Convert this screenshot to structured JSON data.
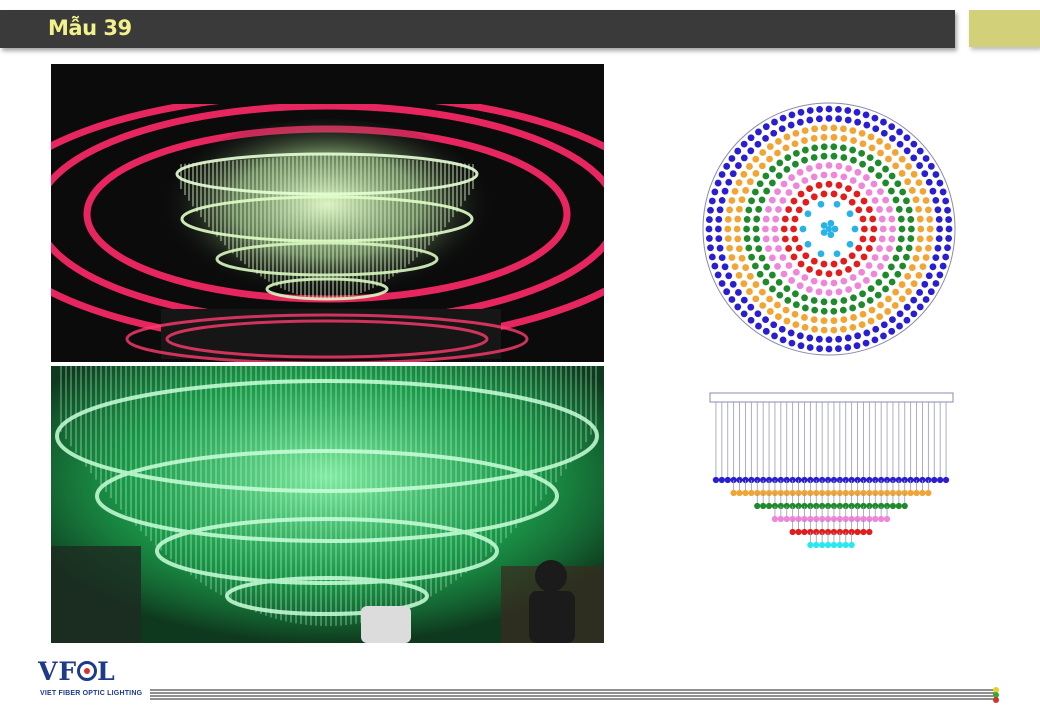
{
  "slide": {
    "title": "Mẫu 39",
    "logo": {
      "mark": "VFOL",
      "subtitle": "VIET FIBER OPTIC LIGHTING"
    }
  },
  "diagram": {
    "rings": [
      {
        "color": "#2a1ed1",
        "dots": 80
      },
      {
        "color": "#2a1ed1",
        "dots": 72
      },
      {
        "color": "#f2a534",
        "dots": 66
      },
      {
        "color": "#f2a534",
        "dots": 58
      },
      {
        "color": "#1f8a2b",
        "dots": 54
      },
      {
        "color": "#1f8a2b",
        "dots": 46
      },
      {
        "color": "#ee86da",
        "dots": 40
      },
      {
        "color": "#ee86da",
        "dots": 34
      },
      {
        "color": "#e11d1d",
        "dots": 28
      },
      {
        "color": "#e11d1d",
        "dots": 22
      },
      {
        "color": "#29b2e8",
        "dots": 10
      },
      {
        "color": "#29b2e8",
        "dots": 5
      }
    ],
    "tiers": [
      {
        "color": "#2a1ed1",
        "dots": 40
      },
      {
        "color": "#f2a534",
        "dots": 34
      },
      {
        "color": "#1f8a2b",
        "dots": 26
      },
      {
        "color": "#ee86da",
        "dots": 20
      },
      {
        "color": "#e11d1d",
        "dots": 14
      },
      {
        "color": "#29e8f0",
        "dots": 8
      }
    ]
  },
  "colors": {
    "title_bar": "#3a3a3a",
    "title_text": "#f3f18c",
    "accent": "#d3d07a"
  }
}
